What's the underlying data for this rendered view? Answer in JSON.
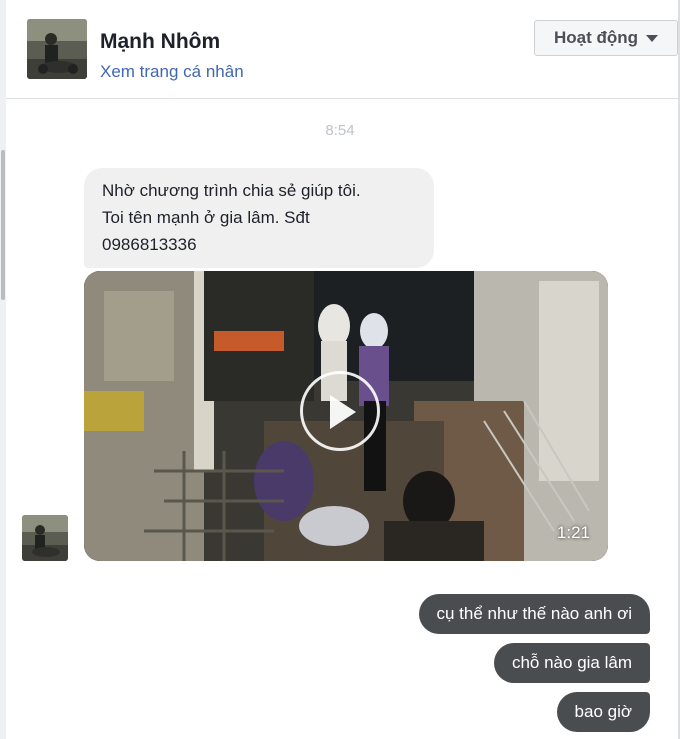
{
  "header": {
    "name": "Mạnh Nhôm",
    "profile_link": "Xem trang cá nhân",
    "status_button": "Hoạt động"
  },
  "conversation": {
    "timestamp": "8:54",
    "incoming_text": {
      "line1": "Nhờ chương trình chia sẻ giúp tôi.",
      "line2": "Toi tên mạnh ở gia lâm. Sđt",
      "line3": "0986813336"
    },
    "video": {
      "duration": "1:21"
    },
    "outgoing": [
      "cụ thể như thế nào anh ơi",
      "chỗ nào gia lâm",
      "bao giờ"
    ]
  },
  "colors": {
    "link": "#4267b2",
    "incoming_bubble": "#f1f0f0",
    "outgoing_bubble": "#4a4d50",
    "timestamp": "#bec3c9"
  },
  "icons": [
    "avatar-image",
    "caret-down-icon",
    "play-icon"
  ]
}
